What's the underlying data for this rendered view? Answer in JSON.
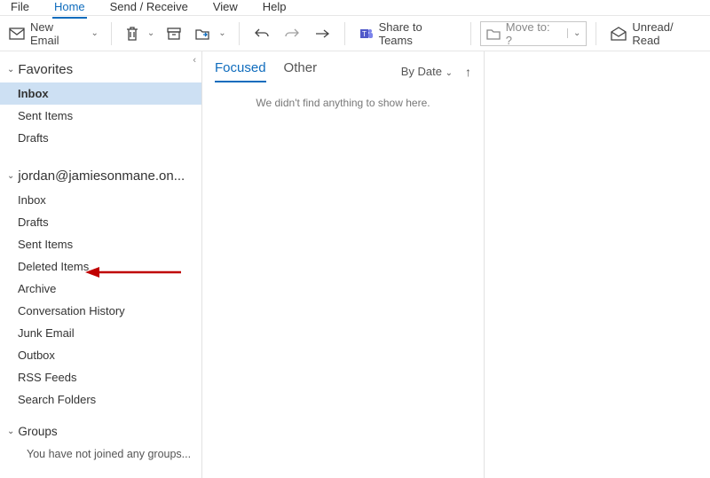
{
  "ribbon": {
    "tabs": [
      "File",
      "Home",
      "Send / Receive",
      "View",
      "Help"
    ],
    "active": 1
  },
  "toolbar": {
    "new_email": "New Email",
    "share_teams": "Share to Teams",
    "moveto_label": "Move to: ?",
    "unread_read": "Unread/ Read"
  },
  "sidebar": {
    "favorites": {
      "title": "Favorites",
      "items": [
        "Inbox",
        "Sent Items",
        "Drafts"
      ],
      "selected": 0
    },
    "account": {
      "title": "jordan@jamiesonmane.on...",
      "items": [
        "Inbox",
        "Drafts",
        "Sent Items",
        "Deleted Items",
        "Archive",
        "Conversation History",
        "Junk Email",
        "Outbox",
        "RSS Feeds",
        "Search Folders"
      ]
    },
    "groups": {
      "title": "Groups",
      "message": "You have not joined any groups..."
    }
  },
  "list": {
    "tabs": [
      "Focused",
      "Other"
    ],
    "active": 0,
    "sort_label": "By Date",
    "empty": "We didn't find anything to show here."
  }
}
